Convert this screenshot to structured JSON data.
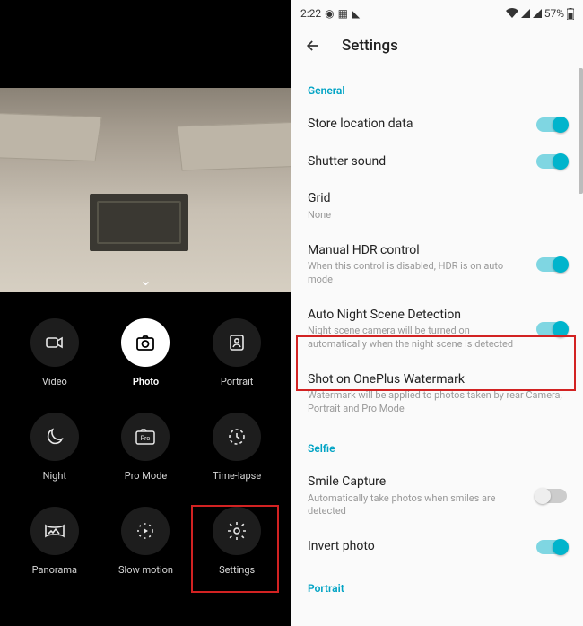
{
  "left": {
    "modes": [
      {
        "id": "video",
        "label": "Video",
        "icon": "video-icon",
        "active": false
      },
      {
        "id": "photo",
        "label": "Photo",
        "icon": "camera-icon",
        "active": true
      },
      {
        "id": "portrait",
        "label": "Portrait",
        "icon": "portrait-icon",
        "active": false
      },
      {
        "id": "night",
        "label": "Night",
        "icon": "moon-icon",
        "active": false
      },
      {
        "id": "pro-mode",
        "label": "Pro Mode",
        "icon": "pro-icon",
        "active": false
      },
      {
        "id": "time-lapse",
        "label": "Time-lapse",
        "icon": "timelapse-icon",
        "active": false
      },
      {
        "id": "panorama",
        "label": "Panorama",
        "icon": "panorama-icon",
        "active": false
      },
      {
        "id": "slow-motion",
        "label": "Slow motion",
        "icon": "slowmo-icon",
        "active": false
      },
      {
        "id": "settings",
        "label": "Settings",
        "icon": "gear-icon",
        "active": false,
        "highlighted": true
      }
    ]
  },
  "right": {
    "statusbar": {
      "time": "2:22",
      "battery_pct": "57%"
    },
    "appbar": {
      "title": "Settings"
    },
    "sections": [
      {
        "header": "General",
        "rows": [
          {
            "label": "Store location data",
            "sub": "",
            "toggle": "on"
          },
          {
            "label": "Shutter sound",
            "sub": "",
            "toggle": "on"
          },
          {
            "label": "Grid",
            "sub": "None",
            "toggle": null
          },
          {
            "label": "Manual HDR control",
            "sub": "When this control is disabled, HDR is on auto mode",
            "toggle": "on"
          },
          {
            "label": "Auto Night Scene Detection",
            "sub": "Night scene camera will be turned on automatically when the night scene is detected",
            "toggle": "on",
            "highlighted": true
          },
          {
            "label": "Shot on OnePlus Watermark",
            "sub": "Watermark will be applied to photos taken by rear Camera, Portrait and Pro Mode",
            "toggle": null
          }
        ]
      },
      {
        "header": "Selfie",
        "rows": [
          {
            "label": "Smile Capture",
            "sub": "Automatically take photos when smiles are detected",
            "toggle": "off"
          },
          {
            "label": "Invert photo",
            "sub": "",
            "toggle": "on"
          }
        ]
      },
      {
        "header": "Portrait",
        "rows": []
      }
    ]
  }
}
